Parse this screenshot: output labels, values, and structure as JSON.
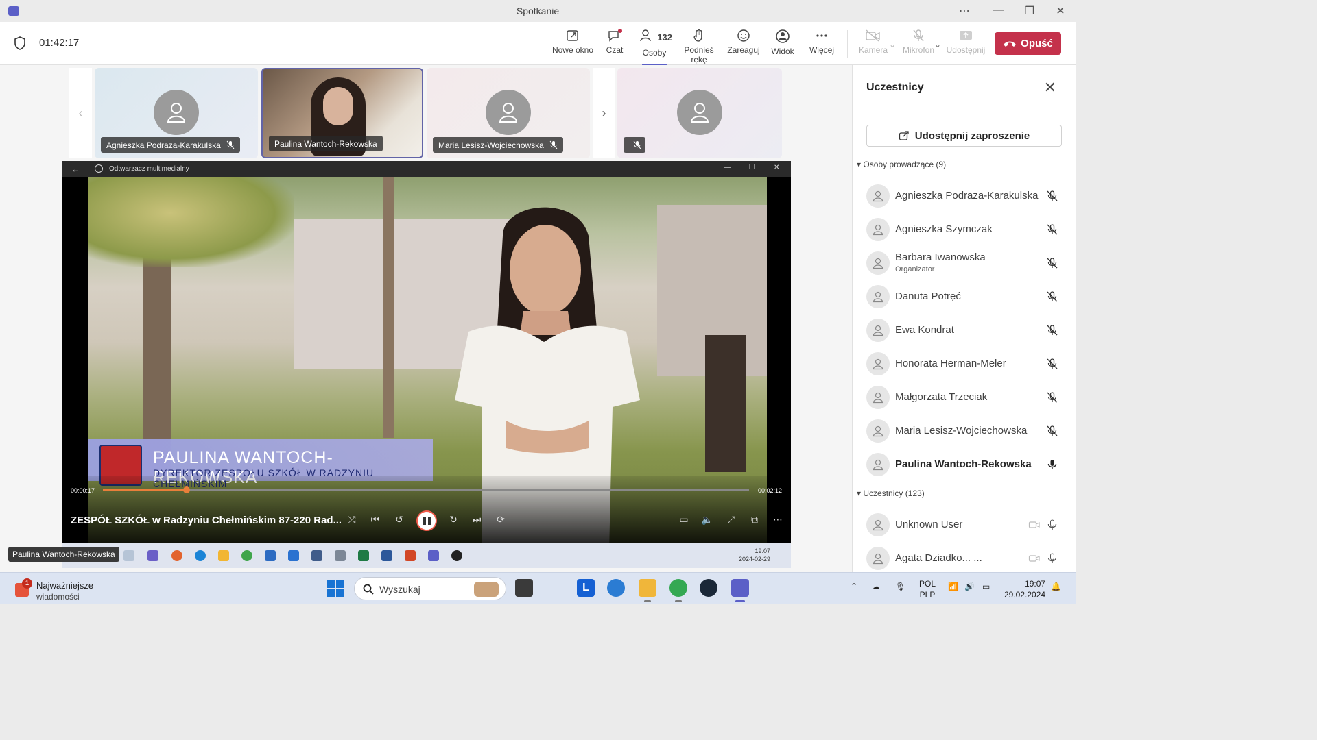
{
  "window": {
    "title": "Spotkanie"
  },
  "toolbar": {
    "timer": "01:42:17",
    "new_window": "Nowe okno",
    "chat": "Czat",
    "people": "Osoby",
    "people_count": "132",
    "raise_hand": "Podnieś rękę",
    "react": "Zareaguj",
    "view": "Widok",
    "more": "Więcej",
    "camera": "Kamera",
    "mic": "Mikrofon",
    "share": "Udostępnij",
    "leave": "Opuść",
    "leave_color": "#c4314b",
    "accent": "#5b5fc7"
  },
  "tiles": [
    {
      "name": "Agnieszka Podraza-Karakulska"
    },
    {
      "name": "Paulina Wantoch-Rekowska"
    },
    {
      "name": "Maria Lesisz-Wojciechowska"
    },
    {
      "name": ""
    }
  ],
  "player": {
    "app": "Odtwarzacz multimedialny",
    "overlay_name": "PAULINA WANTOCH-REKOWSKA",
    "overlay_role": "DYREKTOR ZESPOŁU SZKÓŁ W RADZYNIU CHEŁMIŃSKIM",
    "current": "00:00:17",
    "total": "00:02:12",
    "progress": 0.13,
    "title": "ZESPÓŁ SZKÓŁ w Radzyniu Chełmińskim 87-220 Rad...",
    "inner_time": "19:07",
    "inner_date": "2024-02-29"
  },
  "tooltip": "Paulina Wantoch-Rekowska",
  "panel": {
    "title": "Uczestnicy",
    "invite": "Udostępnij zaproszenie",
    "presenters_header": "Osoby prowadzące (9)",
    "presenters": [
      {
        "name": "Agnieszka Podraza-Karakulska",
        "role": "",
        "mic": "muted"
      },
      {
        "name": "Agnieszka Szymczak",
        "role": "",
        "mic": "muted"
      },
      {
        "name": "Barbara Iwanowska",
        "role": "Organizator",
        "mic": "muted"
      },
      {
        "name": "Danuta Potręć",
        "role": "",
        "mic": "muted"
      },
      {
        "name": "Ewa Kondrat",
        "role": "",
        "mic": "muted"
      },
      {
        "name": "Honorata Herman-Meler",
        "role": "",
        "mic": "muted"
      },
      {
        "name": "Małgorzata Trzeciak",
        "role": "",
        "mic": "muted"
      },
      {
        "name": "Maria Lesisz-Wojciechowska",
        "role": "",
        "mic": "muted"
      },
      {
        "name": "Paulina Wantoch-Rekowska",
        "role": "",
        "mic": "on"
      }
    ],
    "attendees_header": "Uczestnicy (123)",
    "attendees": [
      {
        "name": "Unknown User"
      },
      {
        "name": "Agata Dziadko... ..."
      }
    ]
  },
  "taskbar": {
    "news_title": "Najważniejsze",
    "news_sub": "wiadomości",
    "news_badge": "1",
    "search": "Wyszukaj",
    "lang1": "POL",
    "lang2": "PLP",
    "time": "19:07",
    "date": "29.02.2024"
  }
}
